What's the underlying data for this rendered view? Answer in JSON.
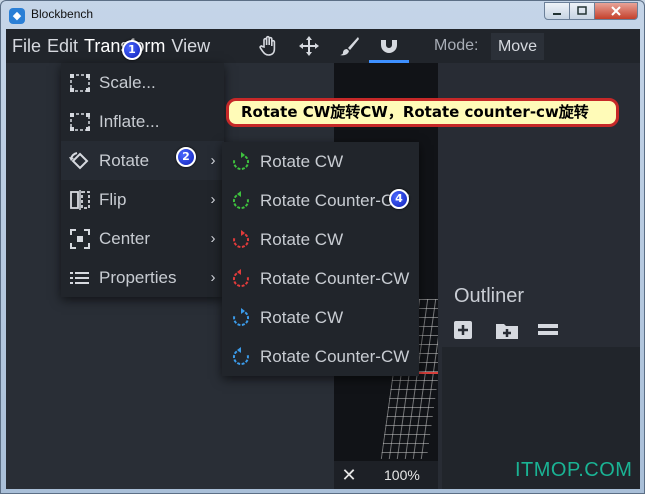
{
  "window": {
    "title": "Blockbench"
  },
  "menubar": {
    "items": [
      {
        "label": "File"
      },
      {
        "label": "Edit"
      },
      {
        "label": "Transform"
      },
      {
        "label": "View"
      }
    ],
    "tools": [
      "hand-icon",
      "move-arrows-icon",
      "brush-icon",
      "magnet-icon"
    ],
    "mode_label": "Mode:",
    "mode_value": "Move"
  },
  "transform_menu": {
    "items": [
      {
        "label": "Scale...",
        "icon": "scale-icon",
        "submenu": false
      },
      {
        "label": "Inflate...",
        "icon": "inflate-icon",
        "submenu": false
      },
      {
        "label": "Rotate",
        "icon": "rotate-icon",
        "submenu": true
      },
      {
        "label": "Flip",
        "icon": "flip-icon",
        "submenu": true
      },
      {
        "label": "Center",
        "icon": "center-icon",
        "submenu": true
      },
      {
        "label": "Properties",
        "icon": "properties-icon",
        "submenu": true
      }
    ]
  },
  "rotate_menu": {
    "items": [
      {
        "label": "Rotate CW",
        "color": "#3ec13e"
      },
      {
        "label": "Rotate Counter-CW",
        "color": "#3ec13e"
      },
      {
        "label": "Rotate CW",
        "color": "#e23b3b"
      },
      {
        "label": "Rotate Counter-CW",
        "color": "#e23b3b"
      },
      {
        "label": "Rotate CW",
        "color": "#3b9bea"
      },
      {
        "label": "Rotate Counter-CW",
        "color": "#3b9bea"
      }
    ]
  },
  "viewport": {
    "zoom": "100%"
  },
  "outliner": {
    "title": "Outliner"
  },
  "annotation": {
    "callout": "Rotate CW旋转CW，Rotate counter-cw旋转",
    "badges": [
      "1",
      "2",
      "4"
    ]
  },
  "watermark": "ITMOP.COM"
}
